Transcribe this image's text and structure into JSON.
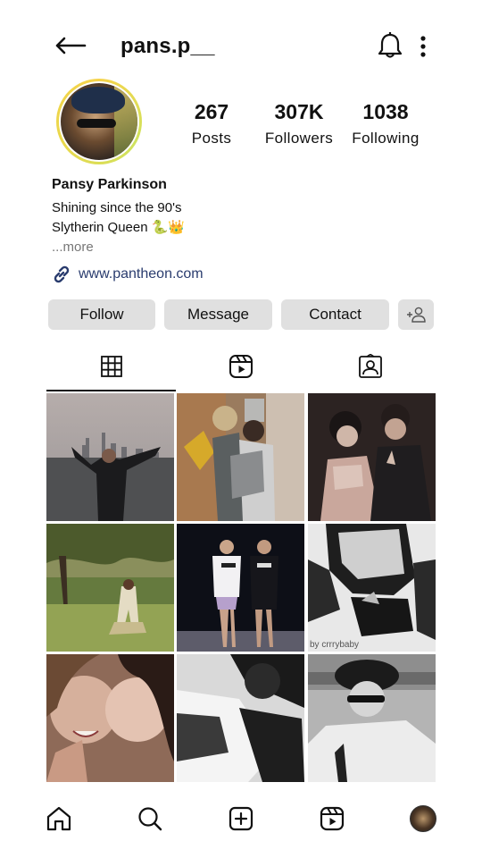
{
  "header": {
    "username": "pans.p__",
    "back_icon": "arrow-left-icon",
    "notification_icon": "bell-icon",
    "more_icon": "more-vertical-icon"
  },
  "profile": {
    "stats": [
      {
        "value": "267",
        "label": "Posts"
      },
      {
        "value": "307K",
        "label": "Followers"
      },
      {
        "value": "1038",
        "label": "Following"
      }
    ],
    "name": "Pansy Parkinson",
    "bio_lines": [
      "Shining since the 90's",
      "Slytherin Queen 🐍👑"
    ],
    "more_label": "...more",
    "website": "www.pantheon.com"
  },
  "actions": {
    "follow_label": "Follow",
    "message_label": "Message",
    "contact_label": "Contact"
  },
  "tabs": [
    {
      "icon": "grid-icon",
      "selected": true
    },
    {
      "icon": "reels-icon",
      "selected": false
    },
    {
      "icon": "tagged-icon",
      "selected": false
    }
  ],
  "grid": {
    "caption_tile6": "by crrrybaby"
  },
  "bottom_nav": [
    {
      "icon": "home-icon"
    },
    {
      "icon": "search-icon"
    },
    {
      "icon": "create-icon"
    },
    {
      "icon": "reels-icon"
    },
    {
      "icon": "profile-avatar-icon"
    }
  ],
  "colors": {
    "button_bg": "#e0e0e0",
    "link": "#2a3c6e",
    "story_ring": "#e9d84c"
  }
}
